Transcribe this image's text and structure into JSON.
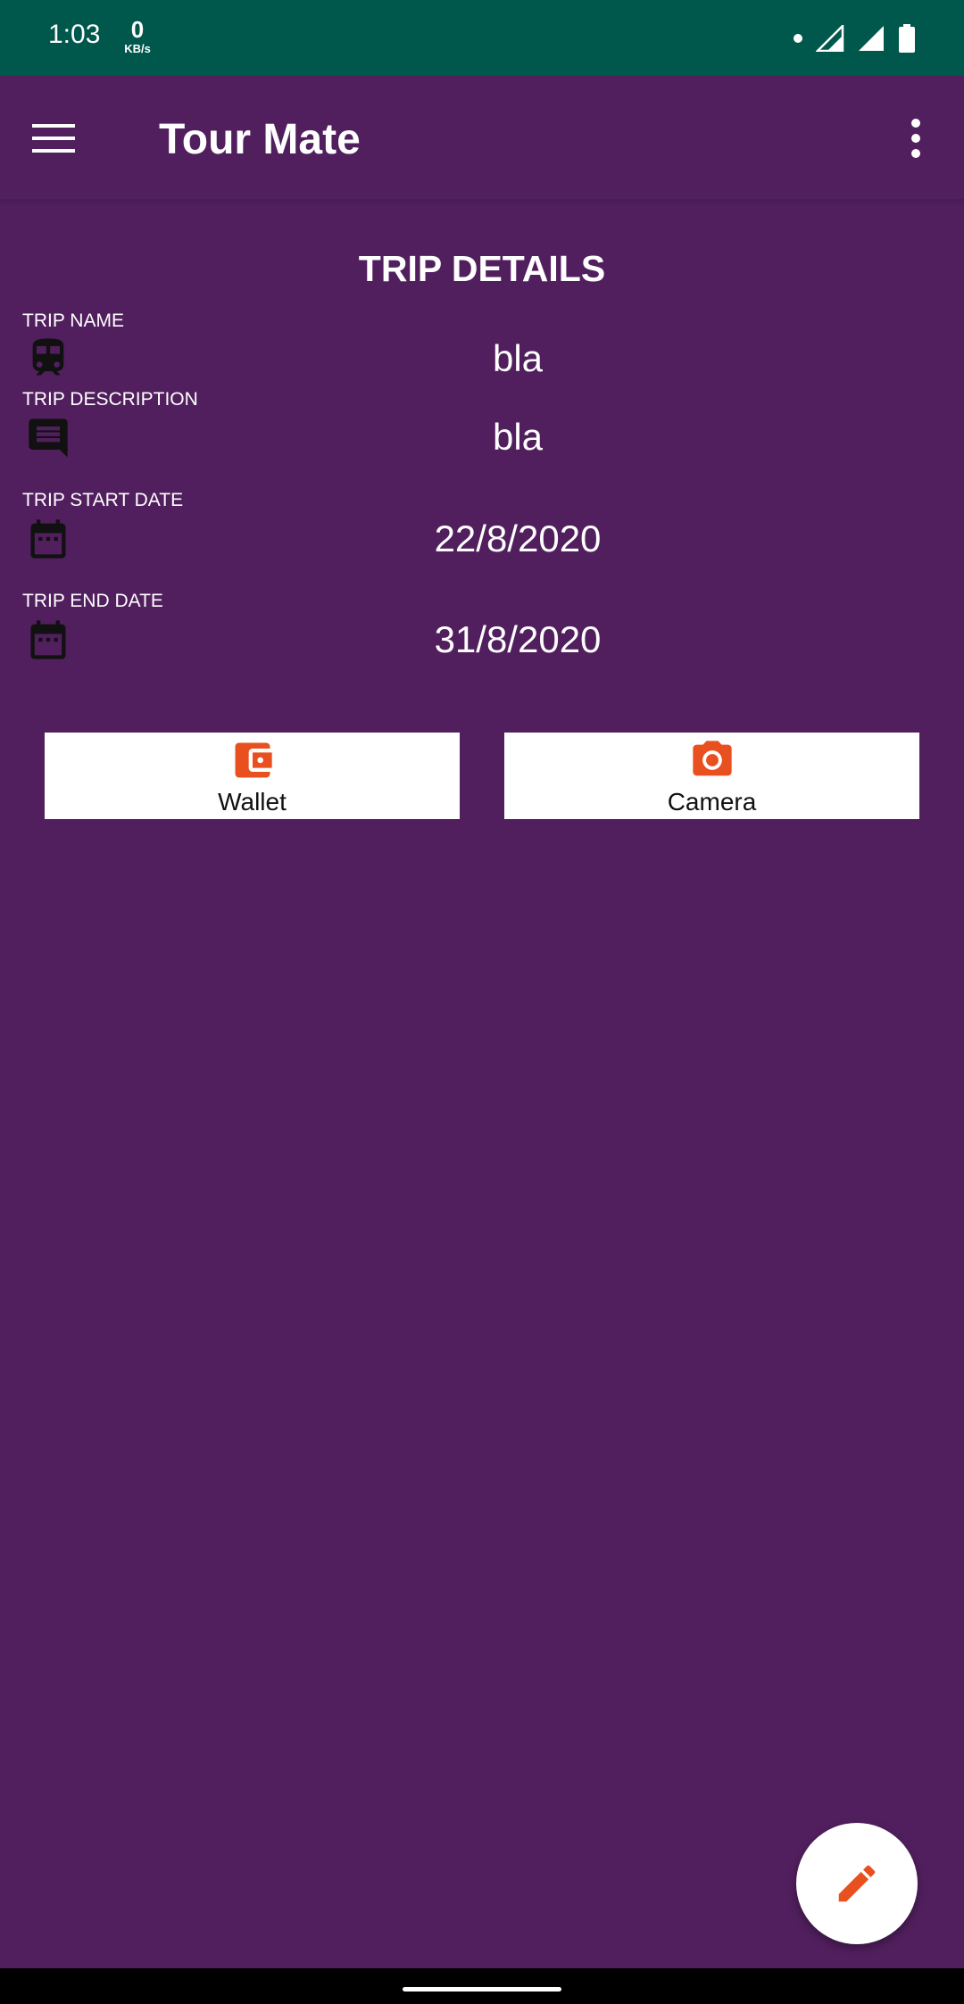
{
  "status_bar": {
    "time": "1:03",
    "net_speed_value": "0",
    "net_speed_unit": "KB/s",
    "icons": [
      "notification-dot-icon",
      "signal-icon",
      "signal-icon",
      "battery-icon"
    ]
  },
  "app_bar": {
    "title": "Tour Mate",
    "menu_icon": "hamburger-menu-icon",
    "overflow_icon": "more-vert-icon"
  },
  "trip_details": {
    "title": "TRIP DETAILS",
    "fields": [
      {
        "label": "TRIP NAME",
        "value": "bla",
        "icon": "train-icon"
      },
      {
        "label": "TRIP DESCRIPTION",
        "value": "bla",
        "icon": "message-icon"
      },
      {
        "label": "TRIP START DATE",
        "value": "22/8/2020",
        "icon": "calendar-icon"
      },
      {
        "label": "TRIP END DATE",
        "value": "31/8/2020",
        "icon": "calendar-icon"
      }
    ]
  },
  "actions": {
    "wallet_label": "Wallet",
    "wallet_icon": "wallet-icon",
    "camera_label": "Camera",
    "camera_icon": "camera-icon"
  },
  "fab": {
    "icon": "edit-pencil-icon"
  },
  "colors": {
    "status_bar": "#00574b",
    "background": "#511f5e",
    "accent": "#e8501f",
    "button_bg": "#ffffff"
  }
}
